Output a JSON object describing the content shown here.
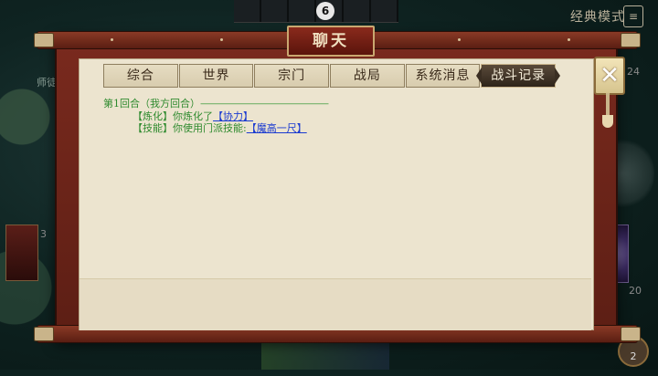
{
  "background": {
    "deck_count": "6",
    "mode_label": "经典模式",
    "mode_icon": "document-icon",
    "left_player_label": "师徒传",
    "left_card_count": "3",
    "right_count_top": "24",
    "right_count_bottom": "20",
    "right_badge_count": "2"
  },
  "dialog": {
    "title": "聊天",
    "tabs": [
      {
        "label": "综合",
        "active": false
      },
      {
        "label": "世界",
        "active": false
      },
      {
        "label": "宗门",
        "active": false
      },
      {
        "label": "战局",
        "active": false
      },
      {
        "label": "系统消息",
        "active": false
      },
      {
        "label": "战斗记录",
        "active": true
      }
    ],
    "close_icon": "close-icon"
  },
  "log": {
    "round_header": "第1回合（我方回合）",
    "round_rule": "——————————————",
    "entries": [
      {
        "tag": "【炼化】",
        "text": "你炼化了",
        "link": "【协力】"
      },
      {
        "tag": "【技能】",
        "text": "你使用门派技能:",
        "link": "【魔高一尺】"
      }
    ]
  },
  "colors": {
    "frame": "#6a2418",
    "panel": "#ece4cf",
    "active_tab": "#3a2e22",
    "log_green": "#2e8a2e",
    "link_blue": "#1a3ad0"
  }
}
